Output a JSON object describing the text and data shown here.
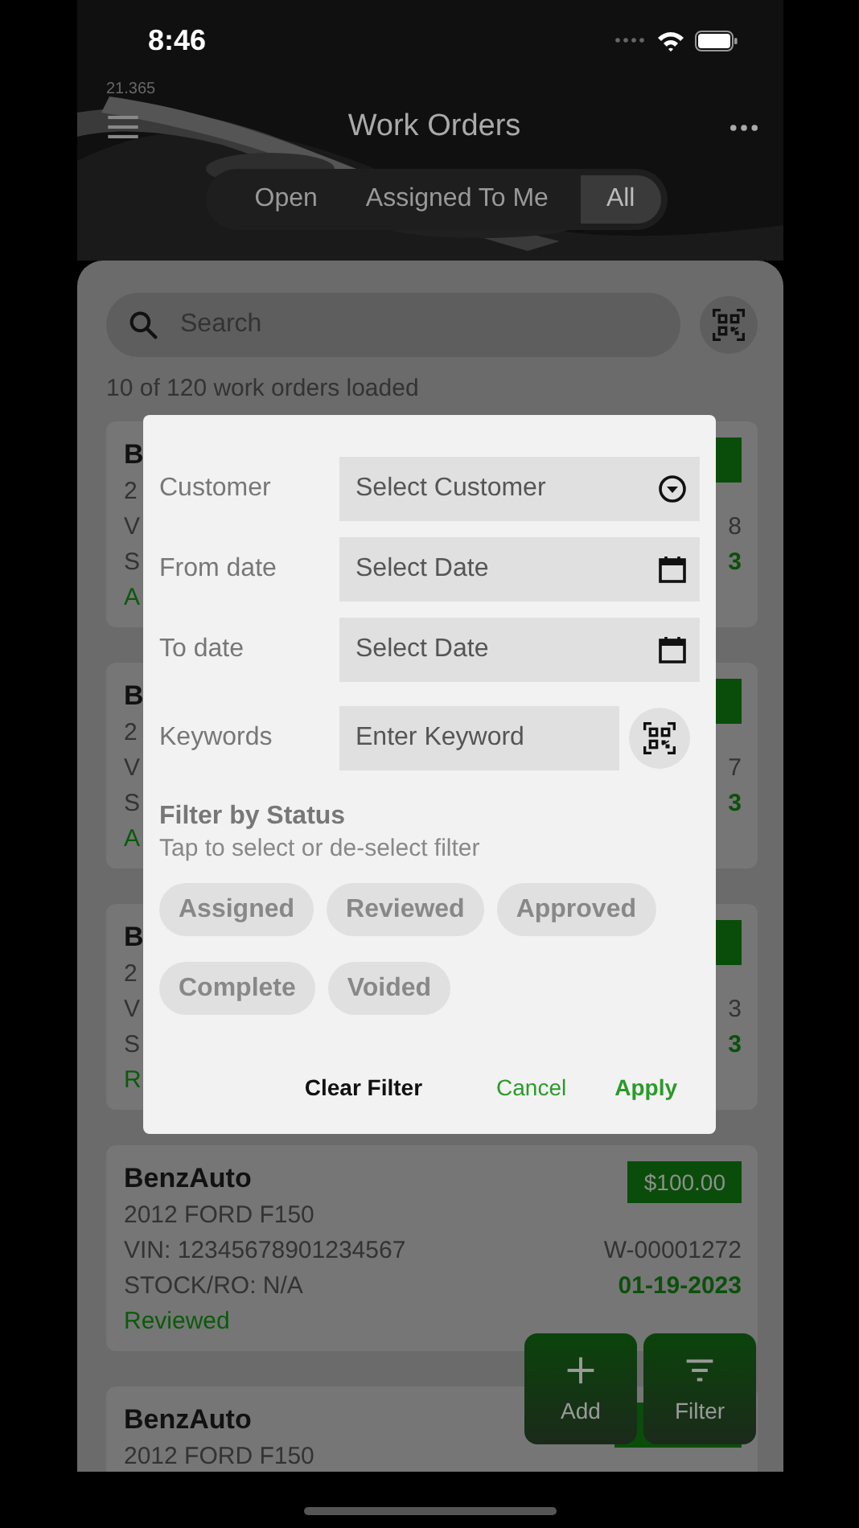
{
  "status_bar": {
    "time": "8:46"
  },
  "version": "21.365",
  "title": "Work Orders",
  "tabs": [
    {
      "label": "Open",
      "selected": false
    },
    {
      "label": "Assigned To Me",
      "selected": false
    },
    {
      "label": "All",
      "selected": true
    }
  ],
  "search": {
    "placeholder": "Search"
  },
  "loaded_count": "10 of 120 work orders loaded",
  "cards": [
    {
      "customer": "B",
      "vehicle": "2",
      "vin": "V",
      "stock": "S",
      "status": "A",
      "number": "8",
      "date": "3"
    },
    {
      "customer": "B",
      "vehicle": "2",
      "vin": "V",
      "stock": "S",
      "status": "A",
      "number": "7",
      "date": "3"
    },
    {
      "customer": "B",
      "vehicle": "2",
      "vin": "V",
      "stock": "S",
      "status": "R",
      "number": "3",
      "date": "3"
    },
    {
      "customer": "BenzAuto",
      "vehicle": "2012 FORD F150",
      "vin": "VIN: 12345678901234567",
      "stock": "STOCK/RO: N/A",
      "status": "Reviewed",
      "price": "$100.00",
      "number": "W-00001272",
      "date": "01-19-2023"
    },
    {
      "customer": "BenzAuto",
      "vehicle": "2012 FORD F150"
    }
  ],
  "filter_dialog": {
    "fields": [
      {
        "label": "Customer",
        "placeholder": "Select Customer",
        "kind": "dropdown"
      },
      {
        "label": "From date",
        "placeholder": "Select Date",
        "kind": "date"
      },
      {
        "label": "To date",
        "placeholder": "Select Date",
        "kind": "date"
      },
      {
        "label": "Keywords",
        "placeholder": "Enter Keyword",
        "kind": "text"
      }
    ],
    "status_title": "Filter by Status",
    "status_hint": "Tap to select or de-select filter",
    "statuses": [
      {
        "label": "Assigned",
        "selected": false
      },
      {
        "label": "Reviewed",
        "selected": false
      },
      {
        "label": "Approved",
        "selected": false
      },
      {
        "label": "Complete",
        "selected": false
      },
      {
        "label": "Voided",
        "selected": false
      }
    ],
    "actions": [
      {
        "label": "Clear Filter",
        "kind": "neutral"
      },
      {
        "label": "Cancel",
        "kind": "secondary"
      },
      {
        "label": "Apply",
        "kind": "primary"
      }
    ]
  },
  "fab_buttons": [
    {
      "label": "Add",
      "kind": "add"
    },
    {
      "label": "Filter",
      "kind": "filter"
    }
  ]
}
